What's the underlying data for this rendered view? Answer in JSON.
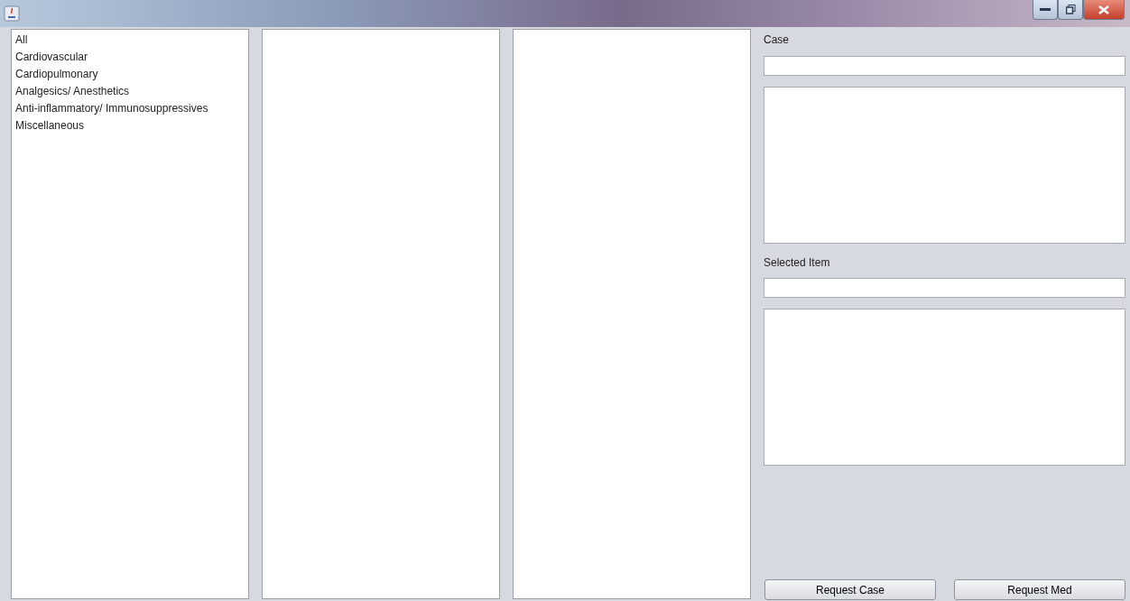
{
  "categories": [
    "All",
    "Cardiovascular",
    "Cardiopulmonary",
    "Analgesics/ Anesthetics",
    "Anti-inflammatory/ Immunosuppressives",
    "Miscellaneous"
  ],
  "case": {
    "label": "Case"
  },
  "selected_item": {
    "label": "Selected Item"
  },
  "buttons": [
    "Request Case",
    "Request Med"
  ]
}
